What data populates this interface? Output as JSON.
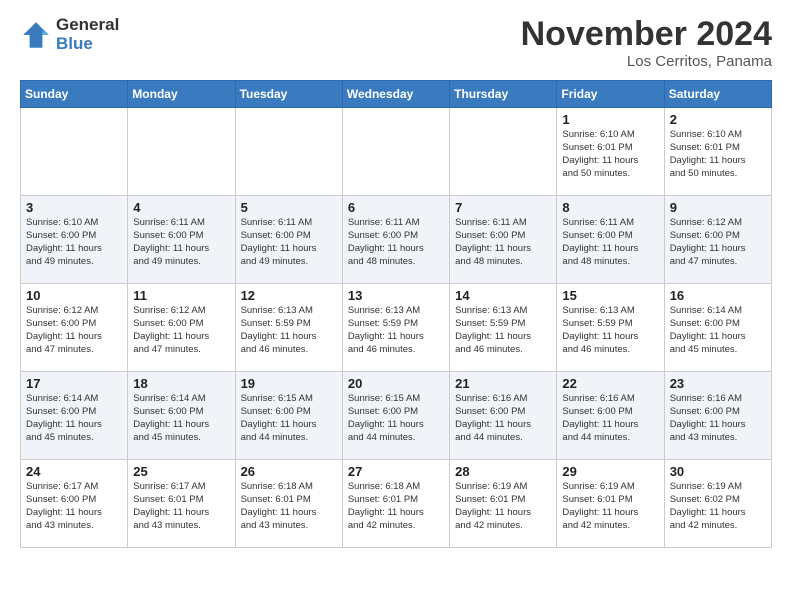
{
  "logo": {
    "general": "General",
    "blue": "Blue"
  },
  "header": {
    "month": "November 2024",
    "location": "Los Cerritos, Panama"
  },
  "weekdays": [
    "Sunday",
    "Monday",
    "Tuesday",
    "Wednesday",
    "Thursday",
    "Friday",
    "Saturday"
  ],
  "weeks": [
    [
      {
        "day": "",
        "info": ""
      },
      {
        "day": "",
        "info": ""
      },
      {
        "day": "",
        "info": ""
      },
      {
        "day": "",
        "info": ""
      },
      {
        "day": "",
        "info": ""
      },
      {
        "day": "1",
        "info": "Sunrise: 6:10 AM\nSunset: 6:01 PM\nDaylight: 11 hours\nand 50 minutes."
      },
      {
        "day": "2",
        "info": "Sunrise: 6:10 AM\nSunset: 6:01 PM\nDaylight: 11 hours\nand 50 minutes."
      }
    ],
    [
      {
        "day": "3",
        "info": "Sunrise: 6:10 AM\nSunset: 6:00 PM\nDaylight: 11 hours\nand 49 minutes."
      },
      {
        "day": "4",
        "info": "Sunrise: 6:11 AM\nSunset: 6:00 PM\nDaylight: 11 hours\nand 49 minutes."
      },
      {
        "day": "5",
        "info": "Sunrise: 6:11 AM\nSunset: 6:00 PM\nDaylight: 11 hours\nand 49 minutes."
      },
      {
        "day": "6",
        "info": "Sunrise: 6:11 AM\nSunset: 6:00 PM\nDaylight: 11 hours\nand 48 minutes."
      },
      {
        "day": "7",
        "info": "Sunrise: 6:11 AM\nSunset: 6:00 PM\nDaylight: 11 hours\nand 48 minutes."
      },
      {
        "day": "8",
        "info": "Sunrise: 6:11 AM\nSunset: 6:00 PM\nDaylight: 11 hours\nand 48 minutes."
      },
      {
        "day": "9",
        "info": "Sunrise: 6:12 AM\nSunset: 6:00 PM\nDaylight: 11 hours\nand 47 minutes."
      }
    ],
    [
      {
        "day": "10",
        "info": "Sunrise: 6:12 AM\nSunset: 6:00 PM\nDaylight: 11 hours\nand 47 minutes."
      },
      {
        "day": "11",
        "info": "Sunrise: 6:12 AM\nSunset: 6:00 PM\nDaylight: 11 hours\nand 47 minutes."
      },
      {
        "day": "12",
        "info": "Sunrise: 6:13 AM\nSunset: 5:59 PM\nDaylight: 11 hours\nand 46 minutes."
      },
      {
        "day": "13",
        "info": "Sunrise: 6:13 AM\nSunset: 5:59 PM\nDaylight: 11 hours\nand 46 minutes."
      },
      {
        "day": "14",
        "info": "Sunrise: 6:13 AM\nSunset: 5:59 PM\nDaylight: 11 hours\nand 46 minutes."
      },
      {
        "day": "15",
        "info": "Sunrise: 6:13 AM\nSunset: 5:59 PM\nDaylight: 11 hours\nand 46 minutes."
      },
      {
        "day": "16",
        "info": "Sunrise: 6:14 AM\nSunset: 6:00 PM\nDaylight: 11 hours\nand 45 minutes."
      }
    ],
    [
      {
        "day": "17",
        "info": "Sunrise: 6:14 AM\nSunset: 6:00 PM\nDaylight: 11 hours\nand 45 minutes."
      },
      {
        "day": "18",
        "info": "Sunrise: 6:14 AM\nSunset: 6:00 PM\nDaylight: 11 hours\nand 45 minutes."
      },
      {
        "day": "19",
        "info": "Sunrise: 6:15 AM\nSunset: 6:00 PM\nDaylight: 11 hours\nand 44 minutes."
      },
      {
        "day": "20",
        "info": "Sunrise: 6:15 AM\nSunset: 6:00 PM\nDaylight: 11 hours\nand 44 minutes."
      },
      {
        "day": "21",
        "info": "Sunrise: 6:16 AM\nSunset: 6:00 PM\nDaylight: 11 hours\nand 44 minutes."
      },
      {
        "day": "22",
        "info": "Sunrise: 6:16 AM\nSunset: 6:00 PM\nDaylight: 11 hours\nand 44 minutes."
      },
      {
        "day": "23",
        "info": "Sunrise: 6:16 AM\nSunset: 6:00 PM\nDaylight: 11 hours\nand 43 minutes."
      }
    ],
    [
      {
        "day": "24",
        "info": "Sunrise: 6:17 AM\nSunset: 6:00 PM\nDaylight: 11 hours\nand 43 minutes."
      },
      {
        "day": "25",
        "info": "Sunrise: 6:17 AM\nSunset: 6:01 PM\nDaylight: 11 hours\nand 43 minutes."
      },
      {
        "day": "26",
        "info": "Sunrise: 6:18 AM\nSunset: 6:01 PM\nDaylight: 11 hours\nand 43 minutes."
      },
      {
        "day": "27",
        "info": "Sunrise: 6:18 AM\nSunset: 6:01 PM\nDaylight: 11 hours\nand 42 minutes."
      },
      {
        "day": "28",
        "info": "Sunrise: 6:19 AM\nSunset: 6:01 PM\nDaylight: 11 hours\nand 42 minutes."
      },
      {
        "day": "29",
        "info": "Sunrise: 6:19 AM\nSunset: 6:01 PM\nDaylight: 11 hours\nand 42 minutes."
      },
      {
        "day": "30",
        "info": "Sunrise: 6:19 AM\nSunset: 6:02 PM\nDaylight: 11 hours\nand 42 minutes."
      }
    ]
  ]
}
